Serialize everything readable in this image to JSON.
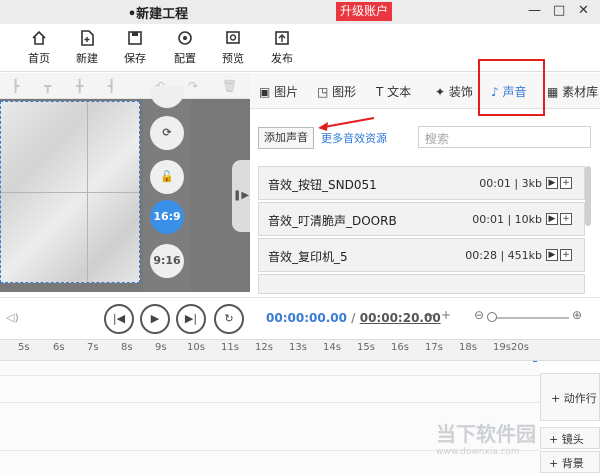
{
  "window": {
    "title": "•新建工程",
    "upgrade_label": "升级账户",
    "minimize": "—",
    "maximize": "□",
    "close": "✕"
  },
  "toolbar": [
    {
      "label": "首页",
      "icon": "home-icon"
    },
    {
      "label": "新建",
      "icon": "new-file-icon"
    },
    {
      "label": "保存",
      "icon": "save-icon"
    },
    {
      "label": "配置",
      "icon": "gear-icon"
    },
    {
      "label": "预览",
      "icon": "preview-icon"
    },
    {
      "label": "发布",
      "icon": "publish-icon"
    }
  ],
  "ratio_buttons": {
    "ratio_169": "16:9",
    "ratio_916": "9:16"
  },
  "tabs": [
    {
      "label": "图片",
      "icon": "image-icon"
    },
    {
      "label": "图形",
      "icon": "shape-icon"
    },
    {
      "label": "文本",
      "icon": "text-icon"
    },
    {
      "label": "装饰",
      "icon": "decoration-icon"
    },
    {
      "label": "声音",
      "icon": "music-icon",
      "active": true
    },
    {
      "label": "素材库",
      "icon": "grid-icon"
    }
  ],
  "sound_panel": {
    "add_label": "添加声音",
    "more_label": "更多音效资源",
    "search_placeholder": "搜索",
    "items": [
      {
        "name": "音效_按钮_SND051",
        "meta": "00:01 | 3kb"
      },
      {
        "name": "音效_叮清脆声_DOORB",
        "meta": "00:01 | 10kb"
      },
      {
        "name": "音效_复印机_5",
        "meta": "00:28 | 451kb"
      }
    ]
  },
  "playback": {
    "current": "00:00:00.00",
    "separator": "/",
    "total": "00:00:20.00"
  },
  "ruler": [
    "5s",
    "6s",
    "7s",
    "8s",
    "9s",
    "10s",
    "11s",
    "12s",
    "13s",
    "14s",
    "15s",
    "16s",
    "17s",
    "18s",
    "19s",
    "20s"
  ],
  "timeline_side": {
    "action": "动作行",
    "lens": "镜头",
    "background": "背景"
  },
  "watermark": {
    "title": "当下软件园",
    "url": "www.downxia.com"
  },
  "colors": {
    "accent": "#3a7bd5",
    "highlight": "#e21f1f",
    "upgrade": "#e9363f"
  }
}
